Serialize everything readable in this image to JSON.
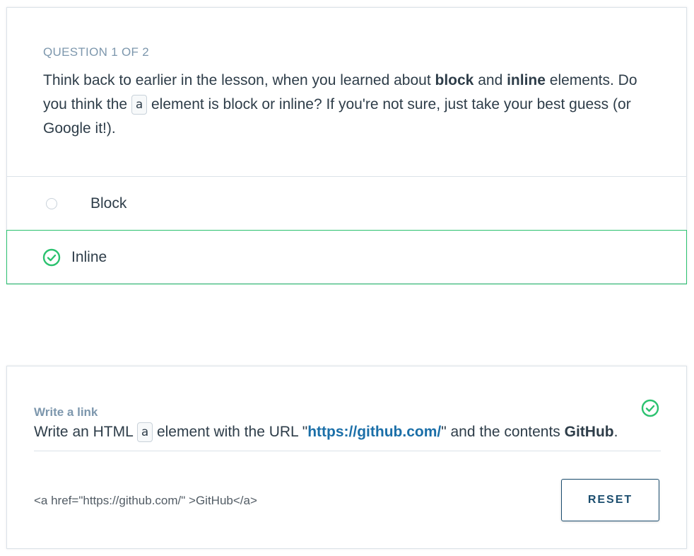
{
  "quiz": {
    "counter": "QUESTION 1 OF 2",
    "prompt": {
      "part1": "Think back to earlier in the lesson, when you learned about ",
      "bold1": "block",
      "part2": " and ",
      "bold2": "inline",
      "part3": " elements. Do you think the ",
      "code": "a",
      "part4": " element is block or inline? If you're not sure, just take your best guess (or Google it!)."
    },
    "options": [
      {
        "label": "Block",
        "selected": false
      },
      {
        "label": "Inline",
        "selected": true
      }
    ]
  },
  "exercise": {
    "title": "Write a link",
    "desc": {
      "part1": "Write an HTML ",
      "code": "a",
      "part2": " element with the URL \"",
      "url": "https://github.com/",
      "part3": "\" and the contents ",
      "bold": "GitHub",
      "part4": "."
    },
    "code_output": "<a href=\"https://github.com/\" >GitHub</a>",
    "reset_label": "RESET",
    "status": "complete"
  },
  "colors": {
    "success": "#2bc26f",
    "text": "#2e3d49",
    "muted": "#7d97ad",
    "link": "#1b6fa8",
    "button": "#1b4d6e"
  }
}
